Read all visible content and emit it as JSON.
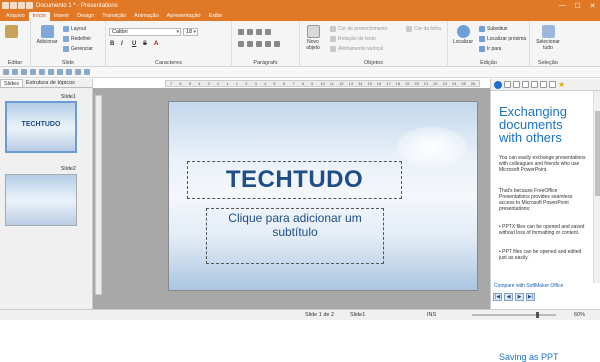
{
  "app": {
    "title": "Documento 1 * - Presentations"
  },
  "tabs": [
    "Arquivo",
    "Início",
    "Inserir",
    "Design",
    "Transição",
    "Animação",
    "Apresentação",
    "Exibir"
  ],
  "active_tab": "Início",
  "ribbon": {
    "groups": [
      "Editar",
      "Slide",
      "Caracteres",
      "Parágrafo",
      "Objetos",
      "Edição",
      "Seleção"
    ],
    "slide_buttons": {
      "adicionar": "Adicionar",
      "layout": "Layout",
      "redefinir": "Redefinir",
      "gerenciar": "Gerenciar"
    },
    "font_name": "Calibri",
    "font_size": "18",
    "format_buttons": [
      "B",
      "I",
      "U",
      "S",
      "A"
    ],
    "novo_objeto": "Novo objeto",
    "objetos": {
      "cor_preenchimento": "Cor de preenchimento",
      "rotacao": "Rotação do texto",
      "alinhamento": "Alinhamento vertical",
      "cor_linha": "Cor da linha"
    },
    "localizar": "Localizar",
    "edicao": {
      "substituir": "Substituir",
      "localizar_proxima": "Localizar próxima",
      "ir_para": "Ir para"
    },
    "selecionar_tudo": "Selecionar tudo"
  },
  "panel": {
    "tabs": [
      "Slides",
      "Estrutura de tópicos"
    ],
    "slides": [
      {
        "label": "Slide1",
        "title": "TECHTUDO"
      },
      {
        "label": "Slide2",
        "title": ""
      }
    ]
  },
  "ruler_ticks": [
    "7",
    "6",
    "5",
    "4",
    "3",
    "2",
    "1",
    "1",
    "2",
    "3",
    "4",
    "5",
    "6",
    "7",
    "8",
    "9",
    "10",
    "11",
    "12",
    "13",
    "14",
    "15",
    "16",
    "17",
    "18",
    "19",
    "20",
    "21",
    "22",
    "23",
    "24",
    "25",
    "26"
  ],
  "slide": {
    "title": "TECHTUDO",
    "subtitle_placeholder": "Clique para adicionar um subtítulo"
  },
  "sidebar": {
    "heading": "Exchanging documents with others",
    "p1": "You can easily exchange presentations with colleagues and friends who use Microsoft PowerPoint.",
    "p2": "That's because FreeOffice Presentations provides seamless access to Microsoft PowerPoint presentations:",
    "b1": "• PPTX files can be opened and saved without loss of formatting or content.",
    "b2": "• PPT files can be opened and edited just as easily.",
    "heading2": "Saving as PPT",
    "link": "Compare with SoftMaker Office"
  },
  "status": {
    "slide": "Slide 1 de 2",
    "layout": "Slide1",
    "mode": "INS",
    "zoom": "60%"
  }
}
